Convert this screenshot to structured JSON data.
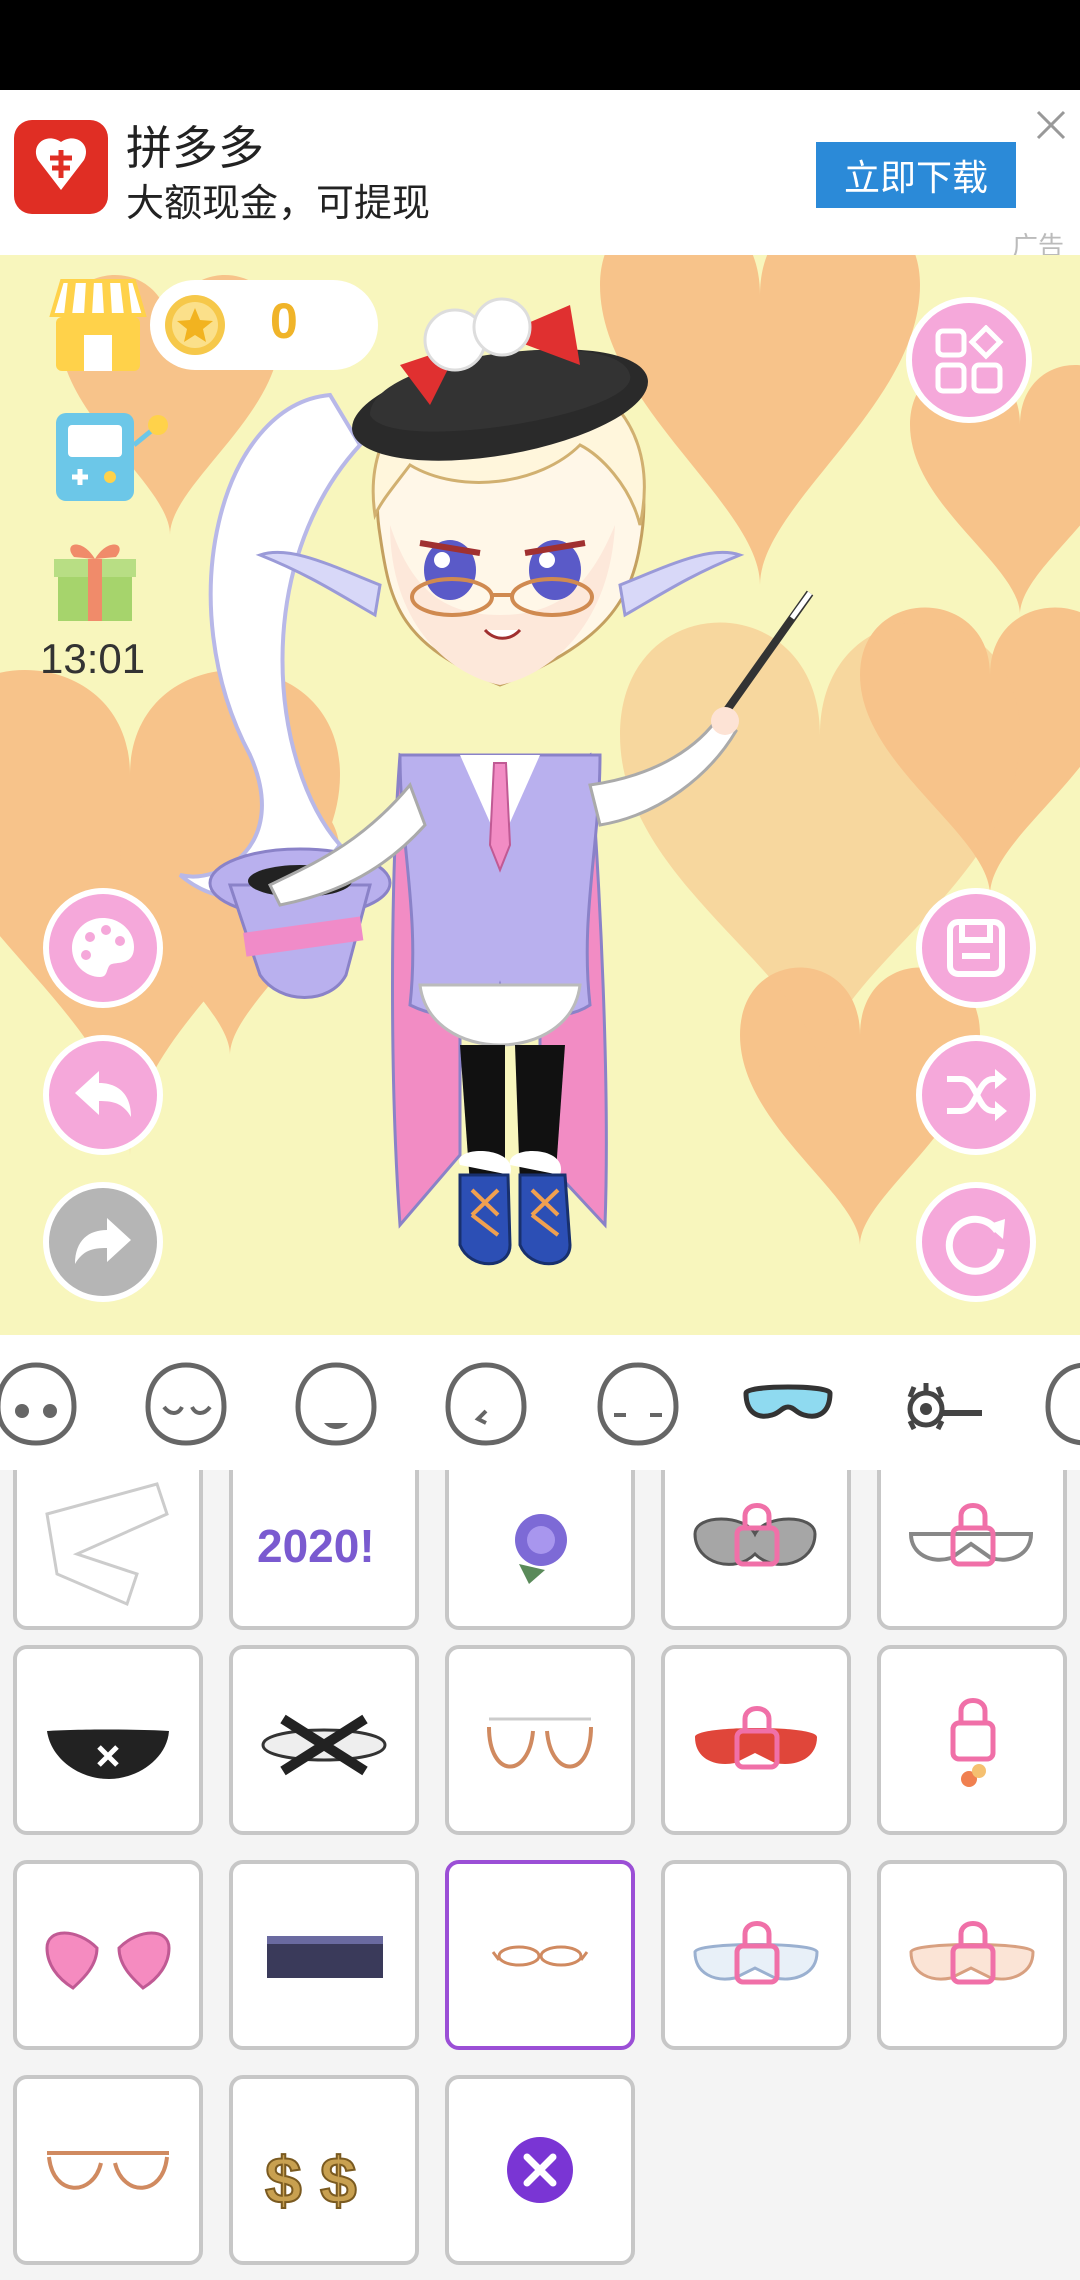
{
  "ad": {
    "app_name": "拼多多",
    "slogan": "大额现金，可提现",
    "download_label": "立即下载",
    "ad_tag": "广告",
    "close_icon": "close-icon"
  },
  "hud": {
    "coin_count": "0",
    "timer": "13:01"
  },
  "categories": [
    {
      "icon": "face-eyes-icon"
    },
    {
      "icon": "face-closed-eyes-icon"
    },
    {
      "icon": "face-mouth-icon"
    },
    {
      "icon": "face-ear-icon"
    },
    {
      "icon": "face-blush-icon"
    },
    {
      "icon": "goggles-icon",
      "selected": true
    },
    {
      "icon": "hair-clip-icon"
    },
    {
      "icon": "face-icon"
    }
  ],
  "accessories": [
    {
      "icon": "bandage-icon",
      "locked": false
    },
    {
      "icon": "2020-glasses-icon",
      "locked": false,
      "text": "2020!"
    },
    {
      "icon": "rose-icon",
      "locked": false
    },
    {
      "icon": "heart-glasses-icon",
      "locked": true
    },
    {
      "icon": "rimless-glasses-icon",
      "locked": true
    },
    {
      "icon": "black-mask-icon",
      "locked": false
    },
    {
      "icon": "eye-mask-icon",
      "locked": false
    },
    {
      "icon": "round-glasses-icon",
      "locked": false
    },
    {
      "icon": "red-glasses-icon",
      "locked": true
    },
    {
      "icon": "flower-earring-icon",
      "locked": true
    },
    {
      "icon": "pink-heart-glasses-icon",
      "locked": false
    },
    {
      "icon": "dark-visor-icon",
      "locked": false
    },
    {
      "icon": "small-glasses-icon",
      "locked": false,
      "selected": true
    },
    {
      "icon": "blue-glasses-icon",
      "locked": true
    },
    {
      "icon": "peach-glasses-icon",
      "locked": true
    },
    {
      "icon": "aviator-glasses-icon",
      "locked": false
    },
    {
      "icon": "dollar-glasses-icon",
      "locked": false,
      "text": "$ $"
    },
    {
      "icon": "remove-icon",
      "locked": false
    }
  ],
  "colors": {
    "accent_pink": "#f5a8da",
    "selected_border": "#9b4fd6",
    "remove_purple": "#7a35d4",
    "ad_button": "#2b8ad8",
    "stage_bg": "#f8f6bd",
    "heart": "#f7b27a"
  }
}
